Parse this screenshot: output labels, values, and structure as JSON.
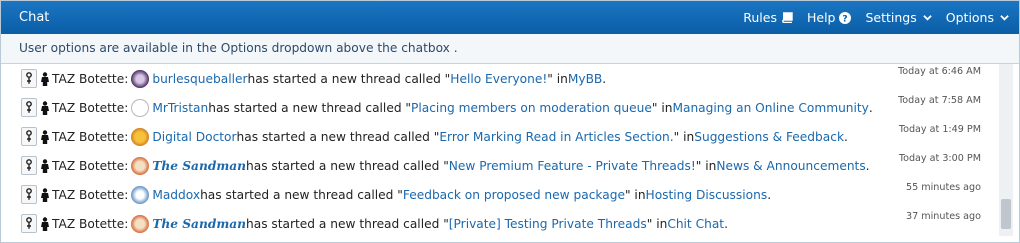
{
  "header": {
    "title": "Chat",
    "nav": [
      {
        "label": "Rules",
        "icon": "book-icon"
      },
      {
        "label": "Help",
        "icon": "question-circle-icon"
      },
      {
        "label": "Settings",
        "icon": "chevron-down-icon"
      },
      {
        "label": "Options",
        "icon": "chevron-down-icon"
      }
    ]
  },
  "notice": "User options are available in the Options dropdown above the chatbox .",
  "messages": [
    {
      "bot": "TAZ Botette:",
      "user": "burlesqueballer",
      "text1": " has started a new thread called \"",
      "thread": "Hello Everyone!",
      "text2": "\" in ",
      "forum": "MyBB",
      "end": ".",
      "time": "Today at 6:46 AM"
    },
    {
      "bot": "TAZ Botette:",
      "user": "MrTristan",
      "text1": " has started a new thread called \"",
      "thread": "Placing members on moderation queue",
      "text2": "\" in ",
      "forum": "Managing an Online Community",
      "end": ".",
      "time": "Today at 7:58 AM"
    },
    {
      "bot": "TAZ Botette:",
      "user": "Digital Doctor",
      "text1": " has started a new thread called \"",
      "thread": "Error Marking Read in Articles Section.",
      "text2": "\" in ",
      "forum": "Suggestions & Feedback",
      "end": ".",
      "time": "Today at 1:49 PM"
    },
    {
      "bot": "TAZ Botette:",
      "user": "The Sandman",
      "text1": " has started a new thread called \"",
      "thread": "New Premium Feature - Private Threads!",
      "text2": "\" in ",
      "forum": "News & Announcements",
      "end": ".",
      "time": "Today at 3:00 PM"
    },
    {
      "bot": "TAZ Botette:",
      "user": "Maddox",
      "text1": " has started a new thread called \"",
      "thread": "Feedback on proposed new package",
      "text2": "\" in ",
      "forum": "Hosting Discussions",
      "end": ".",
      "time": "55 minutes ago"
    },
    {
      "bot": "TAZ Botette:",
      "user": "The Sandman",
      "text1": " has started a new thread called \"",
      "thread": "[Private] Testing Private Threads",
      "text2": "\" in ",
      "forum": "Chit Chat",
      "end": ".",
      "time": "37 minutes ago"
    }
  ],
  "colors": {
    "header": "#0a5ea6",
    "link": "#1b68ad",
    "admin": "#0a2a8a",
    "green_user": "#2f8a2b"
  }
}
